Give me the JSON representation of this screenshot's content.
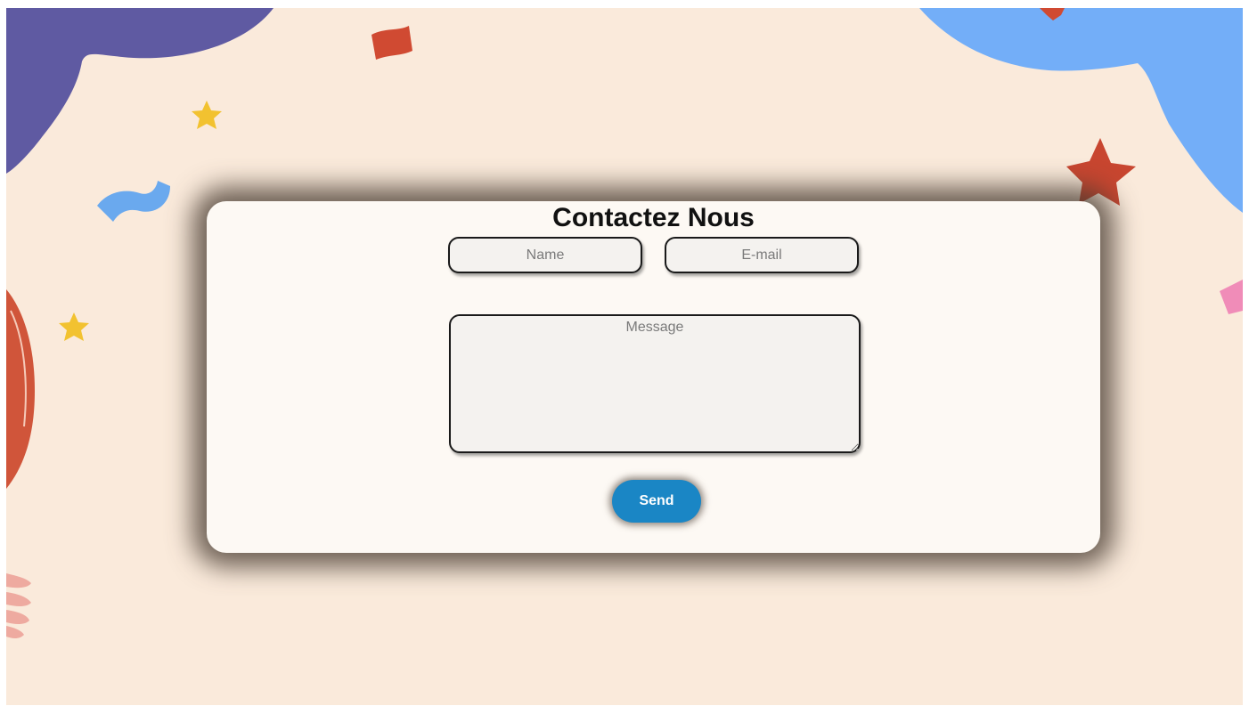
{
  "page": {
    "background_color": "#faeadb",
    "card_color": "#fdf9f4",
    "accent_color": "#1a86c5"
  },
  "form": {
    "title": "Contactez Nous",
    "name_placeholder": "Name",
    "email_placeholder": "E-mail",
    "message_placeholder": "Message",
    "send_label": "Send"
  },
  "decorations": {
    "icons": [
      "purple-blob-icon",
      "blue-blob-icon",
      "star-icon",
      "confetti-icon",
      "squiggle-icon",
      "balloon-icon",
      "hand-icon"
    ],
    "colors": {
      "purple": "#5f5aa2",
      "blue": "#73aef8",
      "red": "#d04a32",
      "yellow": "#f2c230",
      "pink": "#f08cb8",
      "light_blue": "#6aa9ee",
      "peach": "#eeaaa0"
    }
  }
}
